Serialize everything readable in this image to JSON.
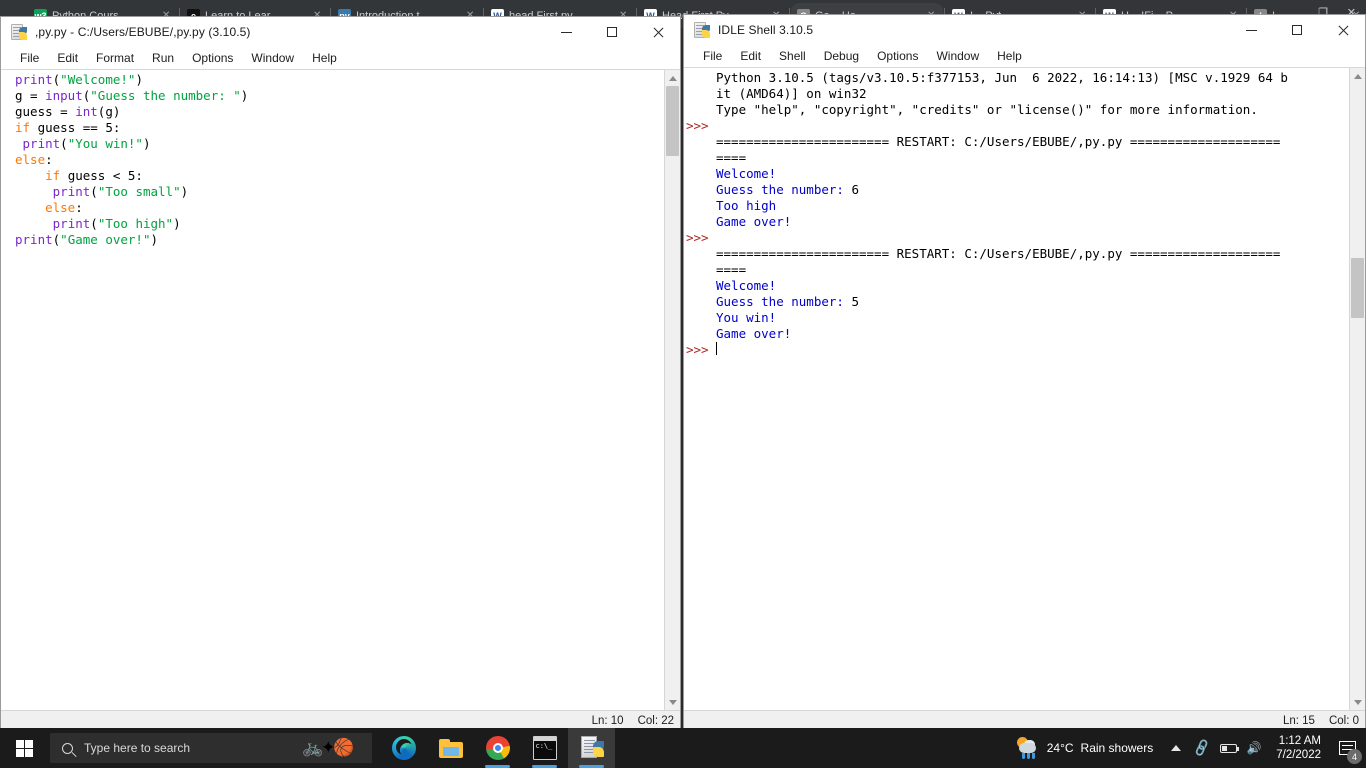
{
  "browser": {
    "tabs": [
      {
        "label": "Python Cours...",
        "favicon": "w3-icon",
        "color": "#0ea05a",
        "glyph": "w3"
      },
      {
        "label": "Learn to Lear...",
        "favicon": "dark-icon",
        "color": "#111111",
        "glyph": "e"
      },
      {
        "label": "Introduction t...",
        "favicon": "python-icon",
        "color": "#3c78a8",
        "glyph": "py"
      },
      {
        "label": "head First py...",
        "favicon": "word-icon",
        "color": "#ffffff",
        "glyph": "W"
      },
      {
        "label": "Head First Py...",
        "favicon": "word-icon",
        "color": "#ffffff",
        "glyph": "W"
      },
      {
        "label": "Ga... Ha...",
        "favicon": "generic-icon",
        "color": "#888888",
        "glyph": "G"
      },
      {
        "label": "I... Pyt...",
        "favicon": "word-icon",
        "color": "#ffffff",
        "glyph": "W"
      },
      {
        "label": "H... IFi... P...",
        "favicon": "word-icon",
        "color": "#ffffff",
        "glyph": "W"
      },
      {
        "label": "I...",
        "favicon": "generic-icon",
        "color": "#888888",
        "glyph": "I"
      }
    ],
    "restore_glyph": "❐",
    "close_glyph": "✕"
  },
  "editor_window": {
    "title": ",py.py - C:/Users/EBUBE/,py.py (3.10.5)",
    "icon_name": "python-file-icon",
    "menu": [
      "File",
      "Edit",
      "Format",
      "Run",
      "Options",
      "Window",
      "Help"
    ],
    "controls": {
      "minimize": "—",
      "maximize": "□",
      "close": "✕"
    },
    "status": {
      "line_label": "Ln: 10",
      "col_label": "Col: 22"
    },
    "code_lines": [
      [
        {
          "t": "print",
          "c": "builtin"
        },
        {
          "t": "(",
          "c": "plain"
        },
        {
          "t": "\"Welcome!\"",
          "c": "string"
        },
        {
          "t": ")",
          "c": "plain"
        }
      ],
      [
        {
          "t": "g = ",
          "c": "plain"
        },
        {
          "t": "input",
          "c": "builtin"
        },
        {
          "t": "(",
          "c": "plain"
        },
        {
          "t": "\"Guess the number: \"",
          "c": "string"
        },
        {
          "t": ")",
          "c": "plain"
        }
      ],
      [
        {
          "t": "guess = ",
          "c": "plain"
        },
        {
          "t": "int",
          "c": "builtin"
        },
        {
          "t": "(g)",
          "c": "plain"
        }
      ],
      [
        {
          "t": "if",
          "c": "kw"
        },
        {
          "t": " guess == 5:",
          "c": "plain"
        }
      ],
      [
        {
          "t": " ",
          "c": "plain"
        },
        {
          "t": "print",
          "c": "builtin"
        },
        {
          "t": "(",
          "c": "plain"
        },
        {
          "t": "\"You win!\"",
          "c": "string"
        },
        {
          "t": ")",
          "c": "plain"
        }
      ],
      [
        {
          "t": "else",
          "c": "kw"
        },
        {
          "t": ":",
          "c": "plain"
        }
      ],
      [
        {
          "t": "    ",
          "c": "plain"
        },
        {
          "t": "if",
          "c": "kw"
        },
        {
          "t": " guess < 5:",
          "c": "plain"
        }
      ],
      [
        {
          "t": "     ",
          "c": "plain"
        },
        {
          "t": "print",
          "c": "builtin"
        },
        {
          "t": "(",
          "c": "plain"
        },
        {
          "t": "\"Too small\"",
          "c": "string"
        },
        {
          "t": ")",
          "c": "plain"
        }
      ],
      [
        {
          "t": "    ",
          "c": "plain"
        },
        {
          "t": "else",
          "c": "kw"
        },
        {
          "t": ":",
          "c": "plain"
        }
      ],
      [
        {
          "t": "     ",
          "c": "plain"
        },
        {
          "t": "print",
          "c": "builtin"
        },
        {
          "t": "(",
          "c": "plain"
        },
        {
          "t": "\"Too high\"",
          "c": "string"
        },
        {
          "t": ")",
          "c": "plain"
        }
      ],
      [
        {
          "t": "print",
          "c": "builtin"
        },
        {
          "t": "(",
          "c": "plain"
        },
        {
          "t": "\"Game over!\"",
          "c": "string"
        },
        {
          "t": ")",
          "c": "plain"
        }
      ]
    ]
  },
  "shell_window": {
    "title": "IDLE Shell 3.10.5",
    "icon_name": "python-shell-icon",
    "menu": [
      "File",
      "Edit",
      "Shell",
      "Debug",
      "Options",
      "Window",
      "Help"
    ],
    "controls": {
      "minimize": "—",
      "maximize": "□",
      "close": "✕"
    },
    "prompt": ">>>",
    "status": {
      "line_label": "Ln: 15",
      "col_label": "Col: 0"
    },
    "lines": [
      {
        "prompt": "",
        "text": "Python 3.10.5 (tags/v3.10.5:f377153, Jun  6 2022, 16:14:13) [MSC v.1929 64 b",
        "style": "black"
      },
      {
        "prompt": "",
        "text": "it (AMD64)] on win32",
        "style": "black"
      },
      {
        "prompt": "",
        "text": "Type \"help\", \"copyright\", \"credits\" or \"license()\" for more information.",
        "style": "black"
      },
      {
        "prompt": ">>>",
        "text": "",
        "style": "black"
      },
      {
        "prompt": "",
        "text": "======================= RESTART: C:/Users/EBUBE/,py.py ====================",
        "style": "restart"
      },
      {
        "prompt": "",
        "text": "====",
        "style": "restart"
      },
      {
        "prompt": "",
        "text": "Welcome!",
        "style": "stdout"
      },
      {
        "prompt": "",
        "text": "Guess the number: ",
        "style": "stdout",
        "input": "6"
      },
      {
        "prompt": "",
        "text": "Too high",
        "style": "stdout"
      },
      {
        "prompt": "",
        "text": "Game over!",
        "style": "stdout"
      },
      {
        "prompt": ">>>",
        "text": "",
        "style": "black"
      },
      {
        "prompt": "",
        "text": "======================= RESTART: C:/Users/EBUBE/,py.py ====================",
        "style": "restart"
      },
      {
        "prompt": "",
        "text": "====",
        "style": "restart"
      },
      {
        "prompt": "",
        "text": "Welcome!",
        "style": "stdout"
      },
      {
        "prompt": "",
        "text": "Guess the number: ",
        "style": "stdout",
        "input": "5"
      },
      {
        "prompt": "",
        "text": "You win!",
        "style": "stdout"
      },
      {
        "prompt": "",
        "text": "Game over!",
        "style": "stdout"
      },
      {
        "prompt": ">>>",
        "text": "",
        "style": "black",
        "caret": true
      }
    ]
  },
  "taskbar": {
    "start_name": "start-button",
    "search": {
      "placeholder": "Type here to search"
    },
    "apps": [
      {
        "name": "edge",
        "running": false,
        "active": false
      },
      {
        "name": "file-explorer",
        "running": false,
        "active": false
      },
      {
        "name": "chrome",
        "running": true,
        "active": false
      },
      {
        "name": "terminal",
        "running": true,
        "active": false
      },
      {
        "name": "python-idle",
        "running": true,
        "active": true
      }
    ],
    "weather": {
      "temperature": "24°C",
      "condition": "Rain showers"
    },
    "clock": {
      "time": "1:12 AM",
      "date": "7/2/2022"
    },
    "notifications": {
      "count": "4"
    }
  },
  "colors": {
    "builtin": "#7d26cd",
    "string": "#00a33f",
    "keyword": "#ff7700",
    "stdout": "#0000cc",
    "prompt": "#b22222",
    "taskbar": "#1b1b1b",
    "accent": "#4aa3df"
  }
}
